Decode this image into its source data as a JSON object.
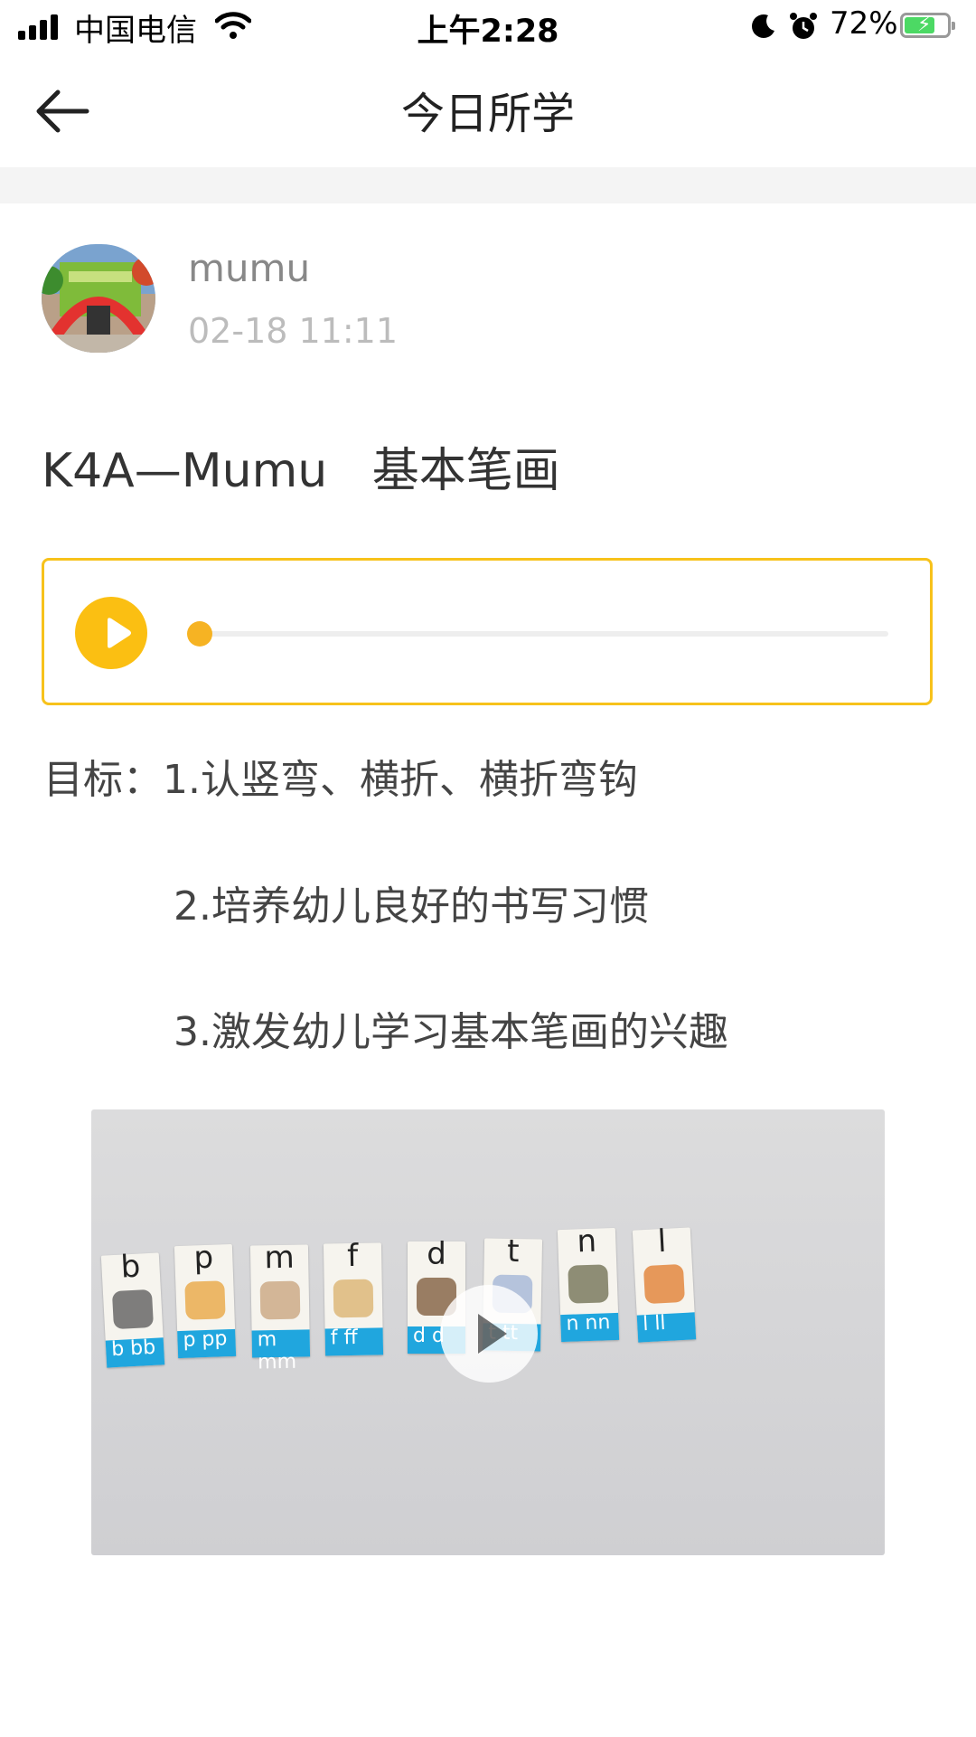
{
  "status_bar": {
    "carrier": "中国电信",
    "time": "上午2:28",
    "battery_percent": "72%",
    "battery_level": 0.72,
    "icons": [
      "signal-icon",
      "wifi-icon",
      "moon-icon",
      "alarm-icon",
      "battery-icon"
    ]
  },
  "nav": {
    "title": "今日所学",
    "back_icon": "back-arrow-icon"
  },
  "post": {
    "author": "mumu",
    "time": "02-18 11:11",
    "title": "K4A—Mumu   基本笔画"
  },
  "audio": {
    "play_icon": "play-icon",
    "progress": 0.0,
    "accent_color": "#f7c21b"
  },
  "goals": [
    "目标：1.认竖弯、横折、横折弯钩",
    "2.培养幼儿良好的书写习惯",
    "3.激发幼儿学习基本笔画的兴趣"
  ],
  "video": {
    "cards": [
      {
        "letter": "b",
        "band": "b bb"
      },
      {
        "letter": "p",
        "band": "p pp"
      },
      {
        "letter": "m",
        "band": "m mm"
      },
      {
        "letter": "f",
        "band": "f ff"
      },
      {
        "letter": "d",
        "band": "d d"
      },
      {
        "letter": "t",
        "band": "t tt"
      },
      {
        "letter": "n",
        "band": "n nn"
      },
      {
        "letter": "l",
        "band": "l ll"
      }
    ],
    "play_icon": "video-play-icon"
  }
}
